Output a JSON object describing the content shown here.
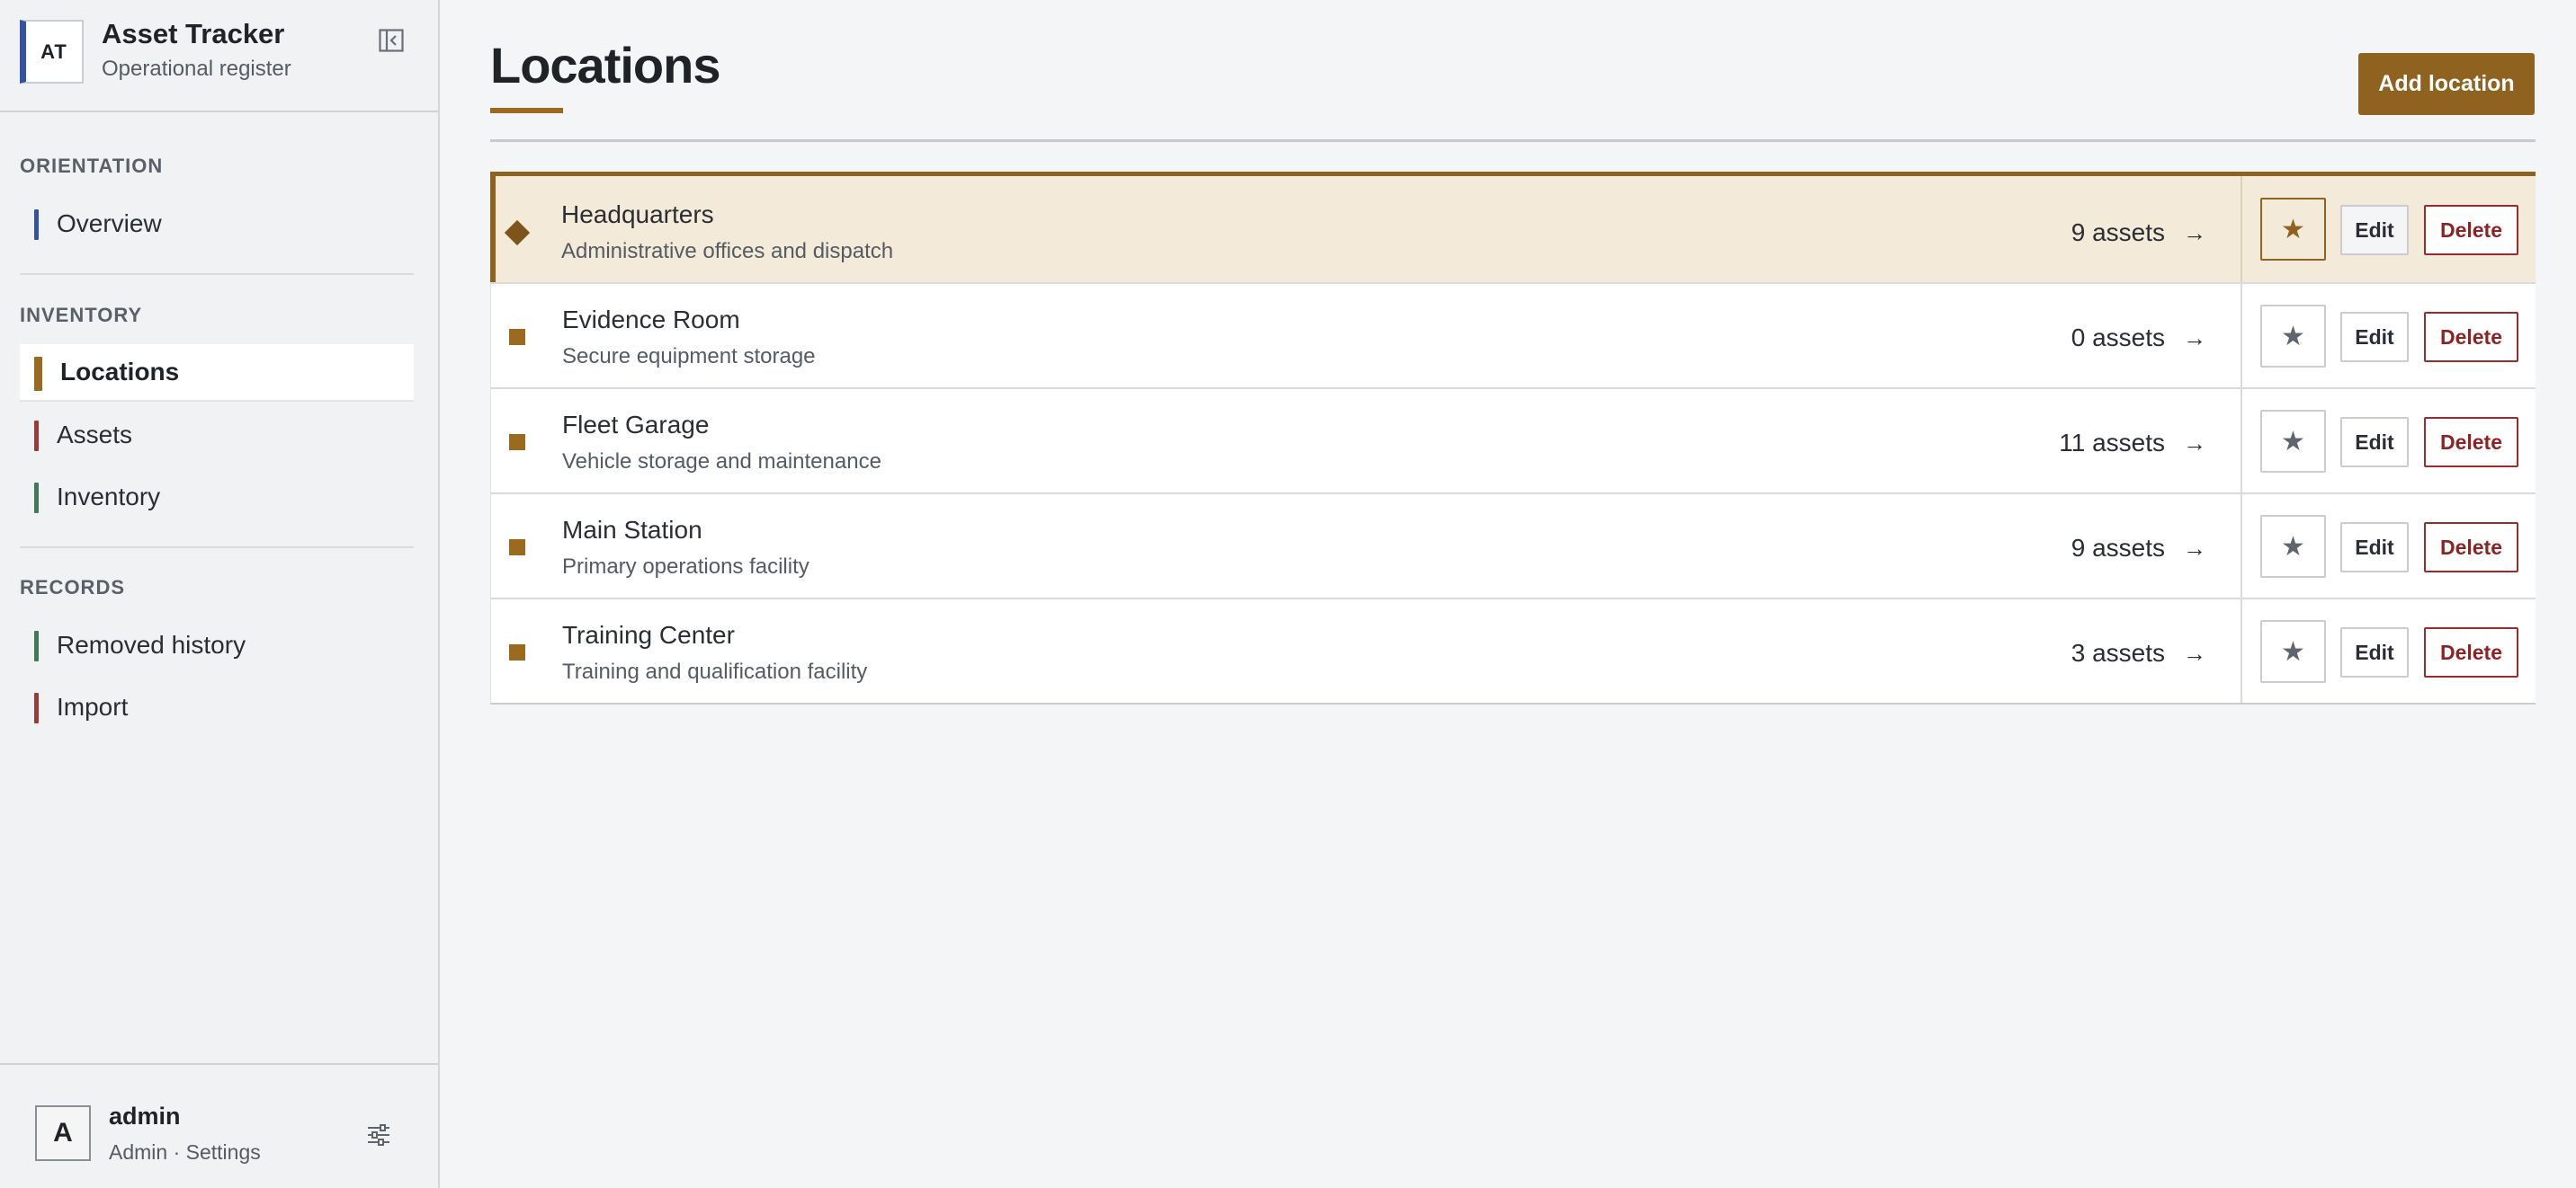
{
  "brand": {
    "logo_text": "AT",
    "title": "Asset Tracker",
    "subtitle": "Operational register",
    "accent_color": "#3452a3"
  },
  "sidebar": {
    "sections": [
      {
        "title": "ORIENTATION",
        "items": [
          {
            "label": "Overview",
            "color": "#3452a3",
            "active": false
          }
        ]
      },
      {
        "title": "INVENTORY",
        "items": [
          {
            "label": "Locations",
            "color": "#9a6a1f",
            "active": true
          },
          {
            "label": "Assets",
            "color": "#9b3a3a",
            "active": false
          },
          {
            "label": "Inventory",
            "color": "#3f7a55",
            "active": false
          }
        ]
      },
      {
        "title": "RECORDS",
        "items": [
          {
            "label": "Removed history",
            "color": "#3f7a55",
            "active": false
          },
          {
            "label": "Import",
            "color": "#9b3a3a",
            "active": false
          }
        ]
      }
    ]
  },
  "user": {
    "avatar_letter": "A",
    "name": "admin",
    "role": "Admin · Settings"
  },
  "main": {
    "title": "Locations",
    "add_button_label": "Add location",
    "accent_color": "#8f6220"
  },
  "locations": [
    {
      "name": "Headquarters",
      "description": "Administrative offices and dispatch",
      "count": "9 assets",
      "selected": true
    },
    {
      "name": "Evidence Room",
      "description": "Secure equipment storage",
      "count": "0 assets",
      "selected": false
    },
    {
      "name": "Fleet Garage",
      "description": "Vehicle storage and maintenance",
      "count": "11 assets",
      "selected": false
    },
    {
      "name": "Main Station",
      "description": "Primary operations facility",
      "count": "9 assets",
      "selected": false
    },
    {
      "name": "Training Center",
      "description": "Training and qualification facility",
      "count": "3 assets",
      "selected": false
    }
  ],
  "row_actions": {
    "star_icon": "star-icon",
    "star_glyph": "★",
    "arrow_glyph": "→",
    "edit_label": "Edit",
    "delete_label": "Delete",
    "delete_color": "#9b2c2c"
  }
}
